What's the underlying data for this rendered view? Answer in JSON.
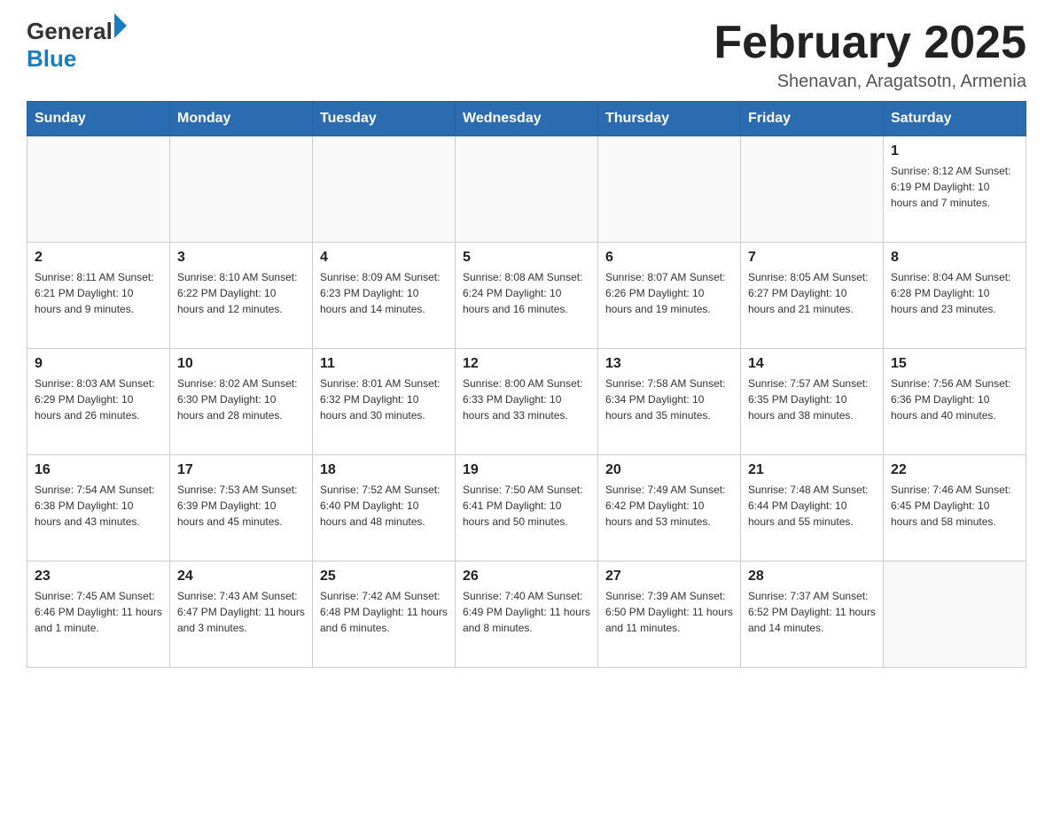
{
  "header": {
    "logo_general": "General",
    "logo_blue": "Blue",
    "month_title": "February 2025",
    "location": "Shenavan, Aragatsotn, Armenia"
  },
  "days_of_week": [
    "Sunday",
    "Monday",
    "Tuesday",
    "Wednesday",
    "Thursday",
    "Friday",
    "Saturday"
  ],
  "weeks": [
    [
      {
        "day": "",
        "info": ""
      },
      {
        "day": "",
        "info": ""
      },
      {
        "day": "",
        "info": ""
      },
      {
        "day": "",
        "info": ""
      },
      {
        "day": "",
        "info": ""
      },
      {
        "day": "",
        "info": ""
      },
      {
        "day": "1",
        "info": "Sunrise: 8:12 AM\nSunset: 6:19 PM\nDaylight: 10 hours and 7 minutes."
      }
    ],
    [
      {
        "day": "2",
        "info": "Sunrise: 8:11 AM\nSunset: 6:21 PM\nDaylight: 10 hours and 9 minutes."
      },
      {
        "day": "3",
        "info": "Sunrise: 8:10 AM\nSunset: 6:22 PM\nDaylight: 10 hours and 12 minutes."
      },
      {
        "day": "4",
        "info": "Sunrise: 8:09 AM\nSunset: 6:23 PM\nDaylight: 10 hours and 14 minutes."
      },
      {
        "day": "5",
        "info": "Sunrise: 8:08 AM\nSunset: 6:24 PM\nDaylight: 10 hours and 16 minutes."
      },
      {
        "day": "6",
        "info": "Sunrise: 8:07 AM\nSunset: 6:26 PM\nDaylight: 10 hours and 19 minutes."
      },
      {
        "day": "7",
        "info": "Sunrise: 8:05 AM\nSunset: 6:27 PM\nDaylight: 10 hours and 21 minutes."
      },
      {
        "day": "8",
        "info": "Sunrise: 8:04 AM\nSunset: 6:28 PM\nDaylight: 10 hours and 23 minutes."
      }
    ],
    [
      {
        "day": "9",
        "info": "Sunrise: 8:03 AM\nSunset: 6:29 PM\nDaylight: 10 hours and 26 minutes."
      },
      {
        "day": "10",
        "info": "Sunrise: 8:02 AM\nSunset: 6:30 PM\nDaylight: 10 hours and 28 minutes."
      },
      {
        "day": "11",
        "info": "Sunrise: 8:01 AM\nSunset: 6:32 PM\nDaylight: 10 hours and 30 minutes."
      },
      {
        "day": "12",
        "info": "Sunrise: 8:00 AM\nSunset: 6:33 PM\nDaylight: 10 hours and 33 minutes."
      },
      {
        "day": "13",
        "info": "Sunrise: 7:58 AM\nSunset: 6:34 PM\nDaylight: 10 hours and 35 minutes."
      },
      {
        "day": "14",
        "info": "Sunrise: 7:57 AM\nSunset: 6:35 PM\nDaylight: 10 hours and 38 minutes."
      },
      {
        "day": "15",
        "info": "Sunrise: 7:56 AM\nSunset: 6:36 PM\nDaylight: 10 hours and 40 minutes."
      }
    ],
    [
      {
        "day": "16",
        "info": "Sunrise: 7:54 AM\nSunset: 6:38 PM\nDaylight: 10 hours and 43 minutes."
      },
      {
        "day": "17",
        "info": "Sunrise: 7:53 AM\nSunset: 6:39 PM\nDaylight: 10 hours and 45 minutes."
      },
      {
        "day": "18",
        "info": "Sunrise: 7:52 AM\nSunset: 6:40 PM\nDaylight: 10 hours and 48 minutes."
      },
      {
        "day": "19",
        "info": "Sunrise: 7:50 AM\nSunset: 6:41 PM\nDaylight: 10 hours and 50 minutes."
      },
      {
        "day": "20",
        "info": "Sunrise: 7:49 AM\nSunset: 6:42 PM\nDaylight: 10 hours and 53 minutes."
      },
      {
        "day": "21",
        "info": "Sunrise: 7:48 AM\nSunset: 6:44 PM\nDaylight: 10 hours and 55 minutes."
      },
      {
        "day": "22",
        "info": "Sunrise: 7:46 AM\nSunset: 6:45 PM\nDaylight: 10 hours and 58 minutes."
      }
    ],
    [
      {
        "day": "23",
        "info": "Sunrise: 7:45 AM\nSunset: 6:46 PM\nDaylight: 11 hours and 1 minute."
      },
      {
        "day": "24",
        "info": "Sunrise: 7:43 AM\nSunset: 6:47 PM\nDaylight: 11 hours and 3 minutes."
      },
      {
        "day": "25",
        "info": "Sunrise: 7:42 AM\nSunset: 6:48 PM\nDaylight: 11 hours and 6 minutes."
      },
      {
        "day": "26",
        "info": "Sunrise: 7:40 AM\nSunset: 6:49 PM\nDaylight: 11 hours and 8 minutes."
      },
      {
        "day": "27",
        "info": "Sunrise: 7:39 AM\nSunset: 6:50 PM\nDaylight: 11 hours and 11 minutes."
      },
      {
        "day": "28",
        "info": "Sunrise: 7:37 AM\nSunset: 6:52 PM\nDaylight: 11 hours and 14 minutes."
      },
      {
        "day": "",
        "info": ""
      }
    ]
  ]
}
